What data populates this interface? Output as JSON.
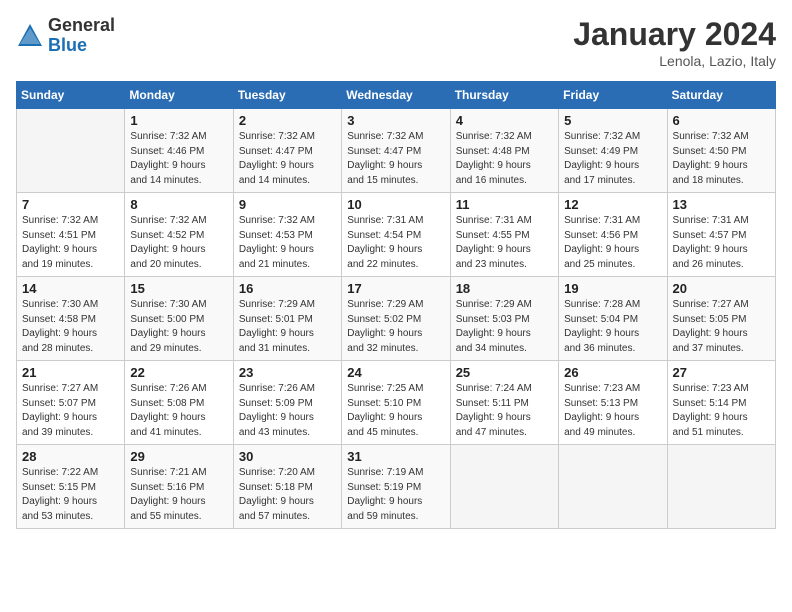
{
  "header": {
    "logo_general": "General",
    "logo_blue": "Blue",
    "title": "January 2024",
    "subtitle": "Lenola, Lazio, Italy"
  },
  "columns": [
    "Sunday",
    "Monday",
    "Tuesday",
    "Wednesday",
    "Thursday",
    "Friday",
    "Saturday"
  ],
  "weeks": [
    [
      {
        "day": "",
        "info": ""
      },
      {
        "day": "1",
        "info": "Sunrise: 7:32 AM\nSunset: 4:46 PM\nDaylight: 9 hours\nand 14 minutes."
      },
      {
        "day": "2",
        "info": "Sunrise: 7:32 AM\nSunset: 4:47 PM\nDaylight: 9 hours\nand 14 minutes."
      },
      {
        "day": "3",
        "info": "Sunrise: 7:32 AM\nSunset: 4:47 PM\nDaylight: 9 hours\nand 15 minutes."
      },
      {
        "day": "4",
        "info": "Sunrise: 7:32 AM\nSunset: 4:48 PM\nDaylight: 9 hours\nand 16 minutes."
      },
      {
        "day": "5",
        "info": "Sunrise: 7:32 AM\nSunset: 4:49 PM\nDaylight: 9 hours\nand 17 minutes."
      },
      {
        "day": "6",
        "info": "Sunrise: 7:32 AM\nSunset: 4:50 PM\nDaylight: 9 hours\nand 18 minutes."
      }
    ],
    [
      {
        "day": "7",
        "info": "Sunrise: 7:32 AM\nSunset: 4:51 PM\nDaylight: 9 hours\nand 19 minutes."
      },
      {
        "day": "8",
        "info": "Sunrise: 7:32 AM\nSunset: 4:52 PM\nDaylight: 9 hours\nand 20 minutes."
      },
      {
        "day": "9",
        "info": "Sunrise: 7:32 AM\nSunset: 4:53 PM\nDaylight: 9 hours\nand 21 minutes."
      },
      {
        "day": "10",
        "info": "Sunrise: 7:31 AM\nSunset: 4:54 PM\nDaylight: 9 hours\nand 22 minutes."
      },
      {
        "day": "11",
        "info": "Sunrise: 7:31 AM\nSunset: 4:55 PM\nDaylight: 9 hours\nand 23 minutes."
      },
      {
        "day": "12",
        "info": "Sunrise: 7:31 AM\nSunset: 4:56 PM\nDaylight: 9 hours\nand 25 minutes."
      },
      {
        "day": "13",
        "info": "Sunrise: 7:31 AM\nSunset: 4:57 PM\nDaylight: 9 hours\nand 26 minutes."
      }
    ],
    [
      {
        "day": "14",
        "info": "Sunrise: 7:30 AM\nSunset: 4:58 PM\nDaylight: 9 hours\nand 28 minutes."
      },
      {
        "day": "15",
        "info": "Sunrise: 7:30 AM\nSunset: 5:00 PM\nDaylight: 9 hours\nand 29 minutes."
      },
      {
        "day": "16",
        "info": "Sunrise: 7:29 AM\nSunset: 5:01 PM\nDaylight: 9 hours\nand 31 minutes."
      },
      {
        "day": "17",
        "info": "Sunrise: 7:29 AM\nSunset: 5:02 PM\nDaylight: 9 hours\nand 32 minutes."
      },
      {
        "day": "18",
        "info": "Sunrise: 7:29 AM\nSunset: 5:03 PM\nDaylight: 9 hours\nand 34 minutes."
      },
      {
        "day": "19",
        "info": "Sunrise: 7:28 AM\nSunset: 5:04 PM\nDaylight: 9 hours\nand 36 minutes."
      },
      {
        "day": "20",
        "info": "Sunrise: 7:27 AM\nSunset: 5:05 PM\nDaylight: 9 hours\nand 37 minutes."
      }
    ],
    [
      {
        "day": "21",
        "info": "Sunrise: 7:27 AM\nSunset: 5:07 PM\nDaylight: 9 hours\nand 39 minutes."
      },
      {
        "day": "22",
        "info": "Sunrise: 7:26 AM\nSunset: 5:08 PM\nDaylight: 9 hours\nand 41 minutes."
      },
      {
        "day": "23",
        "info": "Sunrise: 7:26 AM\nSunset: 5:09 PM\nDaylight: 9 hours\nand 43 minutes."
      },
      {
        "day": "24",
        "info": "Sunrise: 7:25 AM\nSunset: 5:10 PM\nDaylight: 9 hours\nand 45 minutes."
      },
      {
        "day": "25",
        "info": "Sunrise: 7:24 AM\nSunset: 5:11 PM\nDaylight: 9 hours\nand 47 minutes."
      },
      {
        "day": "26",
        "info": "Sunrise: 7:23 AM\nSunset: 5:13 PM\nDaylight: 9 hours\nand 49 minutes."
      },
      {
        "day": "27",
        "info": "Sunrise: 7:23 AM\nSunset: 5:14 PM\nDaylight: 9 hours\nand 51 minutes."
      }
    ],
    [
      {
        "day": "28",
        "info": "Sunrise: 7:22 AM\nSunset: 5:15 PM\nDaylight: 9 hours\nand 53 minutes."
      },
      {
        "day": "29",
        "info": "Sunrise: 7:21 AM\nSunset: 5:16 PM\nDaylight: 9 hours\nand 55 minutes."
      },
      {
        "day": "30",
        "info": "Sunrise: 7:20 AM\nSunset: 5:18 PM\nDaylight: 9 hours\nand 57 minutes."
      },
      {
        "day": "31",
        "info": "Sunrise: 7:19 AM\nSunset: 5:19 PM\nDaylight: 9 hours\nand 59 minutes."
      },
      {
        "day": "",
        "info": ""
      },
      {
        "day": "",
        "info": ""
      },
      {
        "day": "",
        "info": ""
      }
    ]
  ]
}
